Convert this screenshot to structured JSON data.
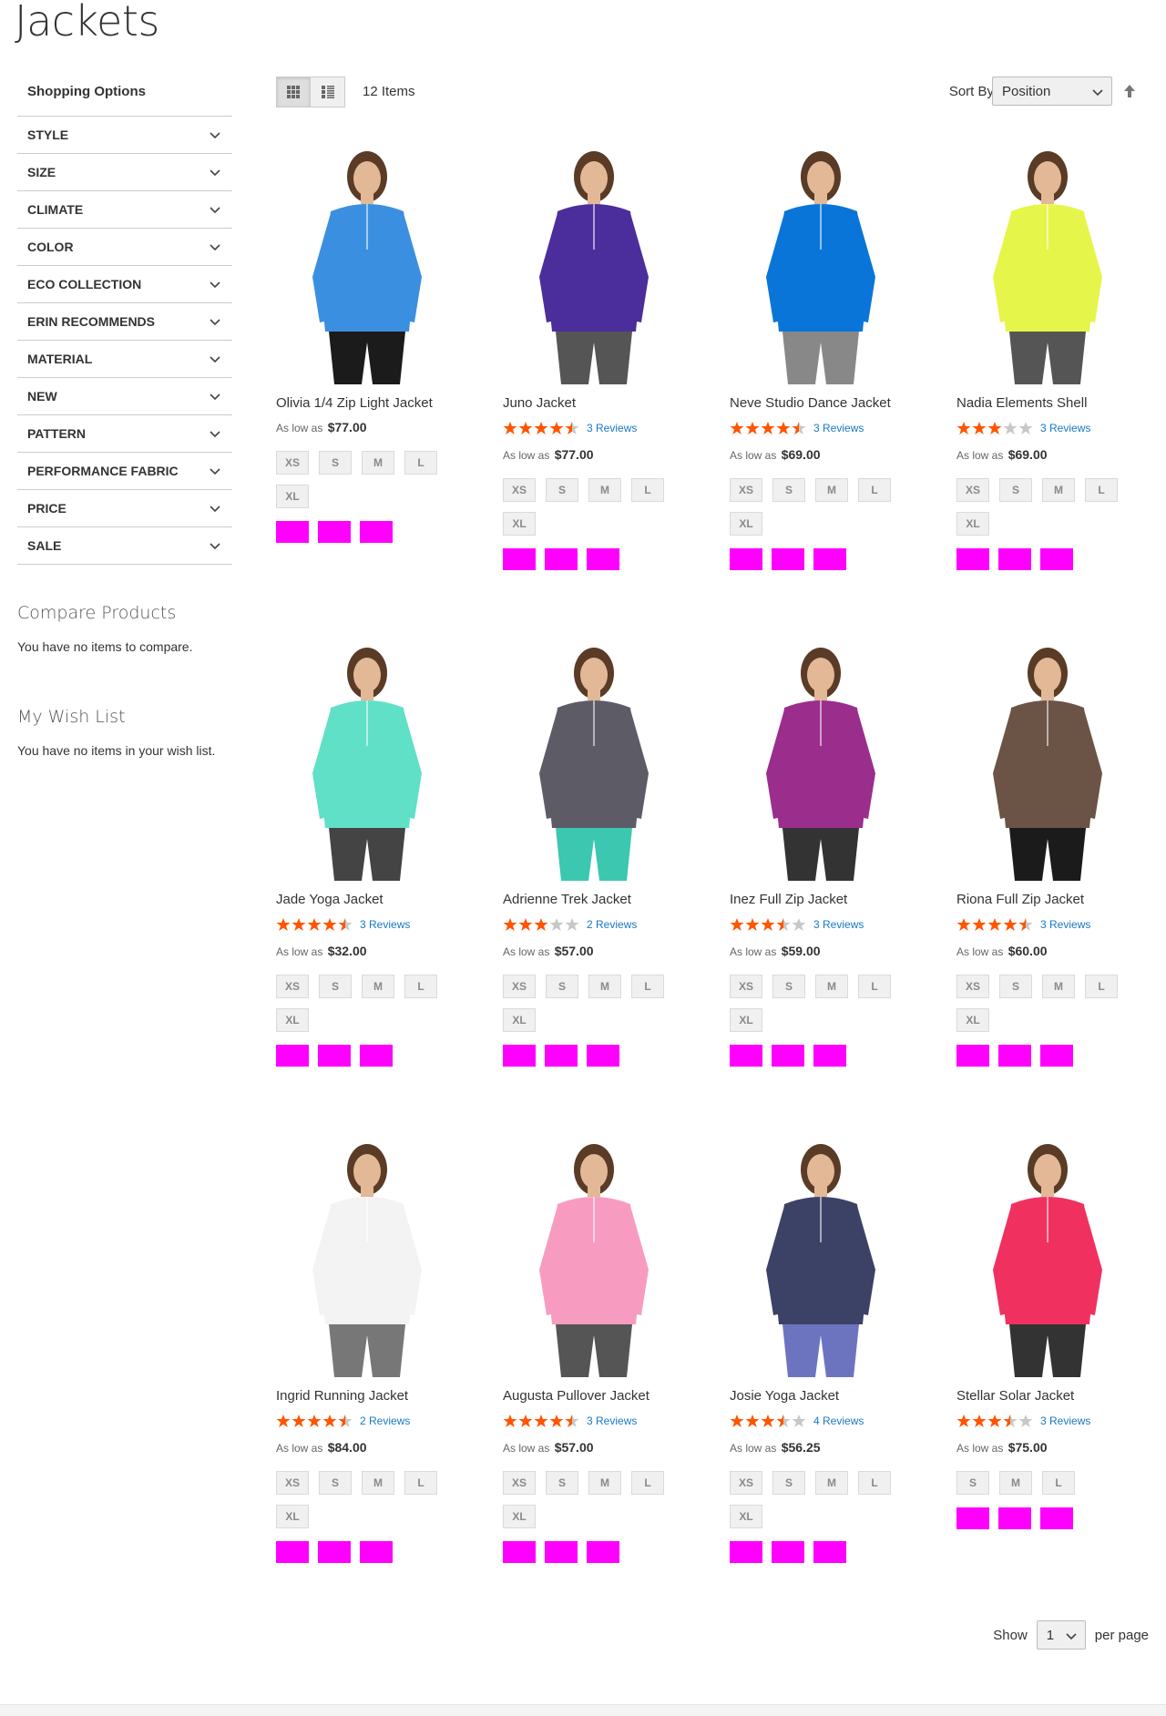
{
  "page": {
    "title": "Jackets"
  },
  "sidebar": {
    "title": "Shopping Options",
    "filters": [
      "STYLE",
      "SIZE",
      "CLIMATE",
      "COLOR",
      "ECO COLLECTION",
      "ERIN RECOMMENDS",
      "MATERIAL",
      "NEW",
      "PATTERN",
      "PERFORMANCE FABRIC",
      "PRICE",
      "SALE"
    ],
    "compare": {
      "title": "Compare Products",
      "text": "You have no items to compare."
    },
    "wishlist": {
      "title": "My Wish List",
      "text": "You have no items in your wish list."
    }
  },
  "toolbar": {
    "items_count": "12 Items",
    "sort_label": "Sort By",
    "sort_value": "Position"
  },
  "colors": {
    "accent": "#ff5501",
    "link": "#1979c3",
    "swatch": "#ff00ff",
    "star_empty": "#c7c7c7"
  },
  "products": [
    {
      "name": "Olivia 1/4 Zip Light Jacket",
      "rating": null,
      "reviews": "",
      "price_prefix": "As low as",
      "price": "$77.00",
      "sizes": [
        "XS",
        "S",
        "M",
        "L",
        "XL"
      ],
      "swatches": 3,
      "color": "#3b8fe0",
      "pants": "#1b1b1b"
    },
    {
      "name": "Juno Jacket",
      "rating": 4.5,
      "reviews": "3 Reviews",
      "price_prefix": "As low as",
      "price": "$77.00",
      "sizes": [
        "XS",
        "S",
        "M",
        "L",
        "XL"
      ],
      "swatches": 3,
      "color": "#4b2e9c",
      "pants": "#555"
    },
    {
      "name": "Neve Studio Dance Jacket",
      "rating": 4.5,
      "reviews": "3 Reviews",
      "price_prefix": "As low as",
      "price": "$69.00",
      "sizes": [
        "XS",
        "S",
        "M",
        "L",
        "XL"
      ],
      "swatches": 3,
      "color": "#0a75d8",
      "pants": "#888"
    },
    {
      "name": "Nadia Elements Shell",
      "rating": 3,
      "reviews": "3 Reviews",
      "price_prefix": "As low as",
      "price": "$69.00",
      "sizes": [
        "XS",
        "S",
        "M",
        "L",
        "XL"
      ],
      "swatches": 3,
      "color": "#e6f54a",
      "pants": "#555"
    },
    {
      "name": "Jade Yoga Jacket",
      "rating": 4.5,
      "reviews": "3 Reviews",
      "price_prefix": "As low as",
      "price": "$32.00",
      "sizes": [
        "XS",
        "S",
        "M",
        "L",
        "XL"
      ],
      "swatches": 3,
      "color": "#5fe0c7",
      "pants": "#444"
    },
    {
      "name": "Adrienne Trek Jacket",
      "rating": 3,
      "reviews": "2 Reviews",
      "price_prefix": "As low as",
      "price": "$57.00",
      "sizes": [
        "XS",
        "S",
        "M",
        "L",
        "XL"
      ],
      "swatches": 3,
      "color": "#5d5c66",
      "pants": "#3cc7b0"
    },
    {
      "name": "Inez Full Zip Jacket",
      "rating": 3.5,
      "reviews": "3 Reviews",
      "price_prefix": "As low as",
      "price": "$59.00",
      "sizes": [
        "XS",
        "S",
        "M",
        "L",
        "XL"
      ],
      "swatches": 3,
      "color": "#9b2d8d",
      "pants": "#333"
    },
    {
      "name": "Riona Full Zip Jacket",
      "rating": 4.5,
      "reviews": "3 Reviews",
      "price_prefix": "As low as",
      "price": "$60.00",
      "sizes": [
        "XS",
        "S",
        "M",
        "L",
        "XL"
      ],
      "swatches": 3,
      "color": "#6b5346",
      "pants": "#1b1b1b"
    },
    {
      "name": "Ingrid Running Jacket",
      "rating": 4.5,
      "reviews": "2 Reviews",
      "price_prefix": "As low as",
      "price": "$84.00",
      "sizes": [
        "XS",
        "S",
        "M",
        "L",
        "XL"
      ],
      "swatches": 3,
      "color": "#f3f3f3",
      "pants": "#777"
    },
    {
      "name": "Augusta Pullover Jacket",
      "rating": 4.5,
      "reviews": "3 Reviews",
      "price_prefix": "As low as",
      "price": "$57.00",
      "sizes": [
        "XS",
        "S",
        "M",
        "L",
        "XL"
      ],
      "swatches": 3,
      "color": "#f79cc0",
      "pants": "#555"
    },
    {
      "name": "Josie Yoga Jacket",
      "rating": 3.5,
      "reviews": "4 Reviews",
      "price_prefix": "As low as",
      "price": "$56.25",
      "sizes": [
        "XS",
        "S",
        "M",
        "L",
        "XL"
      ],
      "swatches": 3,
      "color": "#3c4265",
      "pants": "#6c74c0"
    },
    {
      "name": "Stellar Solar Jacket",
      "rating": 3.5,
      "reviews": "3 Reviews",
      "price_prefix": "As low as",
      "price": "$75.00",
      "sizes": [
        "S",
        "M",
        "L"
      ],
      "swatches": 3,
      "color": "#f0315f",
      "pants": "#333"
    }
  ],
  "pager": {
    "show_label": "Show",
    "limit": "1",
    "per_page_label": "per page"
  }
}
